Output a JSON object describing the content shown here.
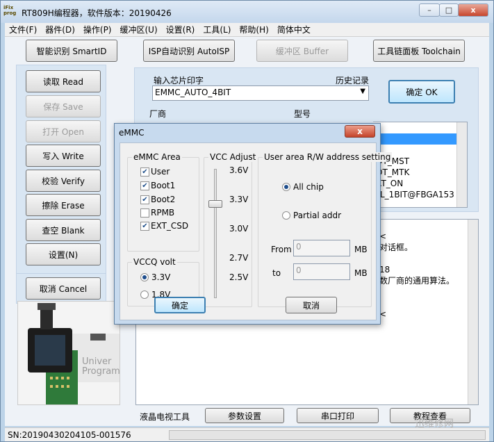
{
  "window": {
    "logo_text": "iFix prog",
    "title": "RT809H编程器，软件版本：20190426",
    "minimize": "–",
    "maximize": "□",
    "close": "x"
  },
  "menu": [
    "文件(F)",
    "器件(D)",
    "操作(P)",
    "缓冲区(U)",
    "设置(R)",
    "工具(L)",
    "帮助(H)",
    "简体中文"
  ],
  "toolbar": {
    "smartid": "智能识别 SmartID",
    "autoisp": "ISP自动识别 AutoISP",
    "buffer": "缓冲区 Buffer",
    "toolchain": "工具链面板 Toolchain"
  },
  "side_buttons": {
    "read": "读取 Read",
    "save": "保存 Save",
    "open": "打开 Open",
    "write": "写入 Write",
    "verify": "校验 Verify",
    "erase": "擦除 Erase",
    "blank": "查空 Blank",
    "settings": "设置(N)",
    "cancel": "取消 Cancel"
  },
  "chip_panel": {
    "input_label": "输入芯片印字",
    "history_label": "历史记录",
    "chip_value": "EMMC_AUTO_4BIT",
    "ok_button": "确定 OK",
    "vendor_header": "厂商",
    "model_header": "型号",
    "models": [
      "",
      "",
      "",
      "OT_MST",
      "OT_MTK",
      "RT_ON",
      "_L_1BIT@FBGA153"
    ]
  },
  "log_panel": {
    "lines": [
      "<",
      "对话框。",
      "",
      "18",
      "数厂商的通用算法。",
      "",
      "",
      "<"
    ]
  },
  "chip_image": {
    "text": "Univer Program"
  },
  "bottom_tabs": {
    "lcd_tools": "液晶电视工具",
    "param_settings": "参数设置",
    "serial_print": "串口打印",
    "tutorial": "教程查看"
  },
  "watermark": "迅维修网",
  "status": {
    "sn": "SN:20190430204105-001576"
  },
  "dialog": {
    "title": "eMMC",
    "close": "x",
    "emmc_area": {
      "title": "eMMC Area",
      "items": [
        {
          "label": "User",
          "checked": true
        },
        {
          "label": "Boot1",
          "checked": true
        },
        {
          "label": "Boot2",
          "checked": true
        },
        {
          "label": "RPMB",
          "checked": false
        },
        {
          "label": "EXT_CSD",
          "checked": true
        }
      ]
    },
    "vccq": {
      "title": "VCCQ volt",
      "options": [
        {
          "label": "3.3V",
          "selected": true
        },
        {
          "label": "1.8V",
          "selected": false
        }
      ]
    },
    "vcc": {
      "title": "VCC Adjust",
      "ticks": [
        "3.6V",
        "3.3V",
        "3.0V",
        "2.7V",
        "2.5V"
      ],
      "value": "3.3V"
    },
    "rw": {
      "title": "User area R/W address setting",
      "all_chip": "All chip",
      "partial": "Partial addr",
      "mode": "All chip",
      "from_label": "From",
      "from_value": "0",
      "to_label": "to",
      "to_value": "0",
      "unit": "MB"
    },
    "ok": "确定",
    "cancel": "取消"
  }
}
